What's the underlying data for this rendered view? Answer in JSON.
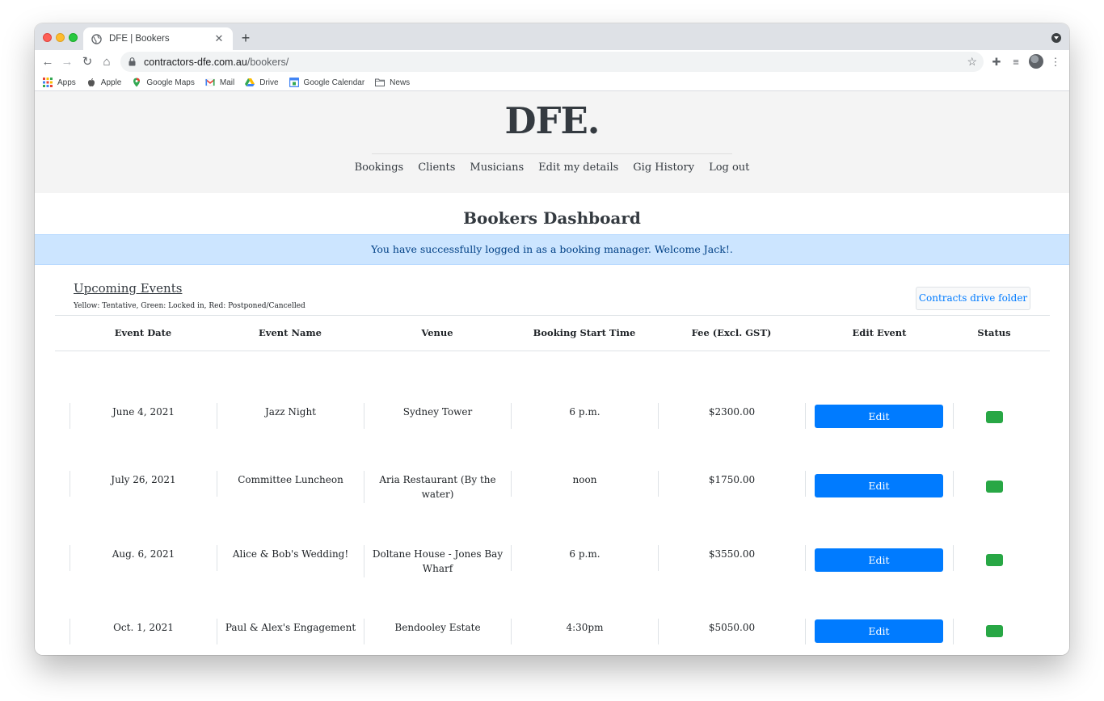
{
  "browser": {
    "tab_title": "DFE | Bookers",
    "url_host": "contractors-dfe.com.au",
    "url_path": "/bookers/",
    "bookmarks": [
      {
        "label": "Apps",
        "icon": "apps-grid-icon"
      },
      {
        "label": "Apple",
        "icon": "apple-icon"
      },
      {
        "label": "Google Maps",
        "icon": "maps-pin-icon"
      },
      {
        "label": "Mail",
        "icon": "gmail-icon"
      },
      {
        "label": "Drive",
        "icon": "drive-icon"
      },
      {
        "label": "Google Calendar",
        "icon": "calendar-icon"
      },
      {
        "label": "News",
        "icon": "folder-icon"
      }
    ]
  },
  "site": {
    "logo": "DFE.",
    "nav": [
      "Bookings",
      "Clients",
      "Musicians",
      "Edit my details",
      "Gig History",
      "Log out"
    ]
  },
  "dashboard": {
    "title": "Bookers Dashboard",
    "alert": "You have successfully logged in as a booking manager. Welcome Jack!.",
    "section_title": "Upcoming Events",
    "legend": "Yellow: Tentative, Green: Locked in, Red: Postponed/Cancelled",
    "drive_button": "Contracts drive folder",
    "columns": [
      "Event Date",
      "Event Name",
      "Venue",
      "Booking Start Time",
      "Fee (Excl. GST)",
      "Edit Event",
      "Status"
    ],
    "edit_label": "Edit",
    "status_color_locked": "#28a745",
    "events": [
      {
        "date": "June 4, 2021",
        "name": "Jazz Night",
        "venue": "Sydney Tower",
        "start": "6 p.m.",
        "fee": "$2300.00",
        "status": "locked"
      },
      {
        "date": "July 26, 2021",
        "name": "Committee Luncheon",
        "venue": "Aria Restaurant (By the water)",
        "start": "noon",
        "fee": "$1750.00",
        "status": "locked"
      },
      {
        "date": "Aug. 6, 2021",
        "name": "Alice & Bob's Wedding!",
        "venue": "Doltane House - Jones Bay Wharf",
        "start": "6 p.m.",
        "fee": "$3550.00",
        "status": "locked"
      },
      {
        "date": "Oct. 1, 2021",
        "name": "Paul & Alex's Engagement",
        "venue": "Bendooley Estate",
        "start": "4:30pm",
        "fee": "$5050.00",
        "status": "locked"
      }
    ]
  }
}
